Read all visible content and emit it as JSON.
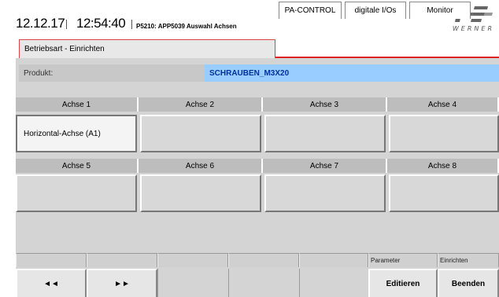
{
  "header": {
    "date": "12.12.17",
    "time": "12:54:40",
    "screen_title": "P5210: APP5039 Auswahl Achsen",
    "logo_text": "WERNER"
  },
  "tabs": {
    "active": "Betriebsart - Einrichten",
    "items": [
      "PA-CONTROL",
      "digitale I/Os",
      "Monitor"
    ]
  },
  "product": {
    "label": "Produkt:",
    "value": "SCHRAUBEN_M3X20"
  },
  "axes": {
    "row1_headers": [
      "Achse 1",
      "Achse 2",
      "Achse 3",
      "Achse 4"
    ],
    "row1_values": [
      "Horizontal-Achse (A1)",
      "",
      "",
      ""
    ],
    "row2_headers": [
      "Achse 5",
      "Achse 6",
      "Achse 7",
      "Achse 8"
    ],
    "row2_values": [
      "",
      "",
      "",
      ""
    ]
  },
  "bottom": {
    "prev": "◄◄",
    "next": "►►",
    "param_header": "Parameter",
    "param_button": "Editieren",
    "setup_header": "Einrichten",
    "setup_button": "Beenden"
  }
}
